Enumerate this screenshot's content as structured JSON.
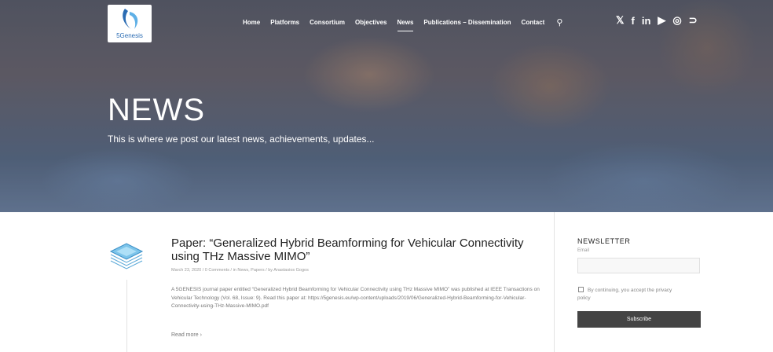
{
  "header": {
    "logo_text": "5Genesis",
    "nav": [
      "Home",
      "Platforms",
      "Consortium",
      "Objectives",
      "News",
      "Publications – Dissemination",
      "Contact"
    ],
    "active_nav": "News",
    "social": [
      "twitter-icon",
      "facebook-icon",
      "linkedin-icon",
      "youtube-icon",
      "instagram-icon",
      "rss-icon"
    ]
  },
  "hero": {
    "title": "NEWS",
    "subtitle": "This is where we post our latest news, achievements, updates..."
  },
  "post": {
    "title": "Paper: “Generalized Hybrid Beamforming for Vehicular Connectivity using THz Massive MIMO”",
    "meta": "March 23, 2020  /  0 Comments  /  in News, Papers  /  by Anastasios Gogos",
    "excerpt": "A 5GENESIS journal paper entitled “Generalized Hybrid Beamforming for Vehicular Connectivity using THz Massive MIMO” was published at IEEE Transactions on Vehicular Technology (Vol. 68, Issue: 9). Read this paper at: https://5genesis.eu/wp-content/uploads/2019/06/Generalized-Hybrid-Beamforming-for-Vehicular-Connectivity-using-THz-Massive-MIMO.pdf",
    "read_more": "Read more ›"
  },
  "newsletter": {
    "title": "NEWSLETTER",
    "email_label": "Email",
    "consent_line1": "By continuing, you accept the privacy",
    "consent_line2": "policy",
    "button": "Subscribe"
  }
}
